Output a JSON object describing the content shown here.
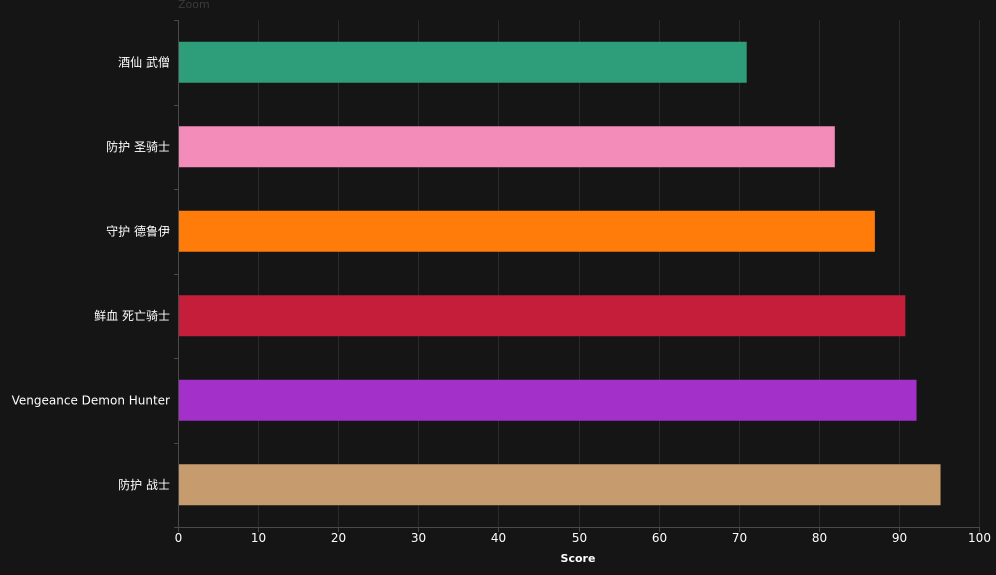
{
  "zoom_label": "Zoom",
  "chart_data": {
    "type": "bar",
    "orientation": "horizontal",
    "categories": [
      "酒仙 武僧",
      "防护 圣骑士",
      "守护 德鲁伊",
      "鲜血 死亡骑士",
      "Vengeance Demon Hunter",
      "防护 战士"
    ],
    "values": [
      71,
      82,
      87,
      90.8,
      92.2,
      95.2
    ],
    "colors": [
      "#2e9e7a",
      "#f48cba",
      "#ff7c0a",
      "#c41e3a",
      "#a330c9",
      "#c69b6d"
    ],
    "xlabel": "Score",
    "ylabel": "",
    "xlim": [
      0,
      100
    ],
    "xticks": [
      0,
      10,
      20,
      30,
      40,
      50,
      60,
      70,
      80,
      90,
      100
    ],
    "grid": true
  }
}
